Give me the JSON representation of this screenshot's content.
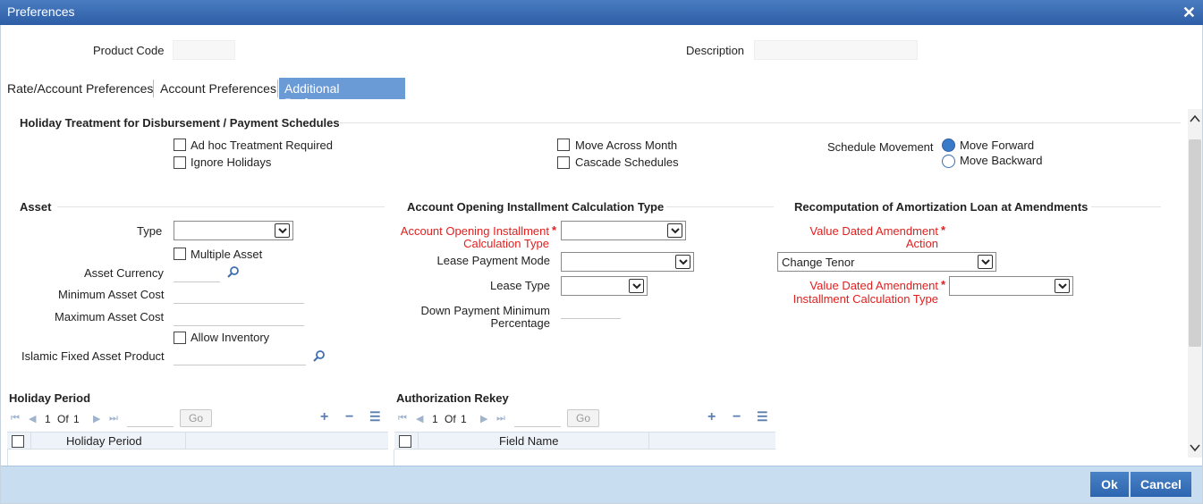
{
  "window": {
    "title": "Preferences",
    "close_glyph": "✕"
  },
  "header": {
    "product_code_label": "Product Code",
    "product_code_value": "",
    "description_label": "Description",
    "description_value": ""
  },
  "tabs": [
    {
      "label": "Rate/Account Preferences",
      "active": false
    },
    {
      "label": "Account Preferences",
      "active": false
    },
    {
      "label": "Additional Preference",
      "active": true
    }
  ],
  "holiday_treatment": {
    "title": "Holiday Treatment for Disbursement / Payment Schedules",
    "adhoc_label": "Ad hoc Treatment Required",
    "adhoc_checked": false,
    "ignore_holidays_label": "Ignore Holidays",
    "ignore_holidays_checked": false,
    "move_across_month_label": "Move Across Month",
    "move_across_month_checked": false,
    "cascade_label": "Cascade Schedules",
    "cascade_checked": false,
    "schedule_movement_label": "Schedule Movement",
    "move_forward_label": "Move Forward",
    "move_backward_label": "Move Backward",
    "schedule_movement_selected": "Move Forward"
  },
  "asset": {
    "title": "Asset",
    "type_label": "Type",
    "type_value": "",
    "multiple_asset_label": "Multiple Asset",
    "multiple_asset_checked": false,
    "currency_label": "Asset Currency",
    "currency_value": "",
    "min_cost_label": "Minimum Asset Cost",
    "min_cost_value": "",
    "max_cost_label": "Maximum Asset Cost",
    "max_cost_value": "",
    "allow_inventory_label": "Allow Inventory",
    "allow_inventory_checked": false,
    "islamic_label": "Islamic Fixed Asset Product",
    "islamic_value": ""
  },
  "installment": {
    "title": "Account Opening Installment Calculation Type",
    "calc_type_label_1": "Account Opening Installment",
    "calc_type_label_2": "Calculation Type",
    "calc_type_value": "",
    "lease_payment_mode_label": "Lease Payment Mode",
    "lease_payment_mode_value": "",
    "lease_type_label": "Lease Type",
    "lease_type_value": "",
    "down_payment_label_1": "Down Payment Minimum",
    "down_payment_label_2": "Percentage",
    "down_payment_value": ""
  },
  "recomputation": {
    "title": "Recomputation of Amortization Loan at Amendments",
    "vda_action_label_1": "Value Dated Amendment",
    "vda_action_label_2": "Action",
    "vda_action_value": "Change Tenor",
    "vda_calc_label_1": "Value Dated Amendment",
    "vda_calc_label_2": "Installment Calculation Type",
    "vda_calc_value": ""
  },
  "required_mark": "*",
  "holiday_period_grid": {
    "title": "Holiday Period",
    "page_current": "1",
    "page_of": "Of",
    "page_total": "1",
    "go_label": "Go",
    "column": "Holiday Period"
  },
  "auth_rekey_grid": {
    "title": "Authorization Rekey",
    "page_current": "1",
    "page_of": "Of",
    "page_total": "1",
    "go_label": "Go",
    "column": "Field Name"
  },
  "footer": {
    "ok_label": "Ok",
    "cancel_label": "Cancel"
  },
  "colors": {
    "title_bar": "#2d5ea6",
    "required": "#e0201f",
    "footer": "#c9ddf0",
    "active_tab": "#6b9bd6"
  }
}
